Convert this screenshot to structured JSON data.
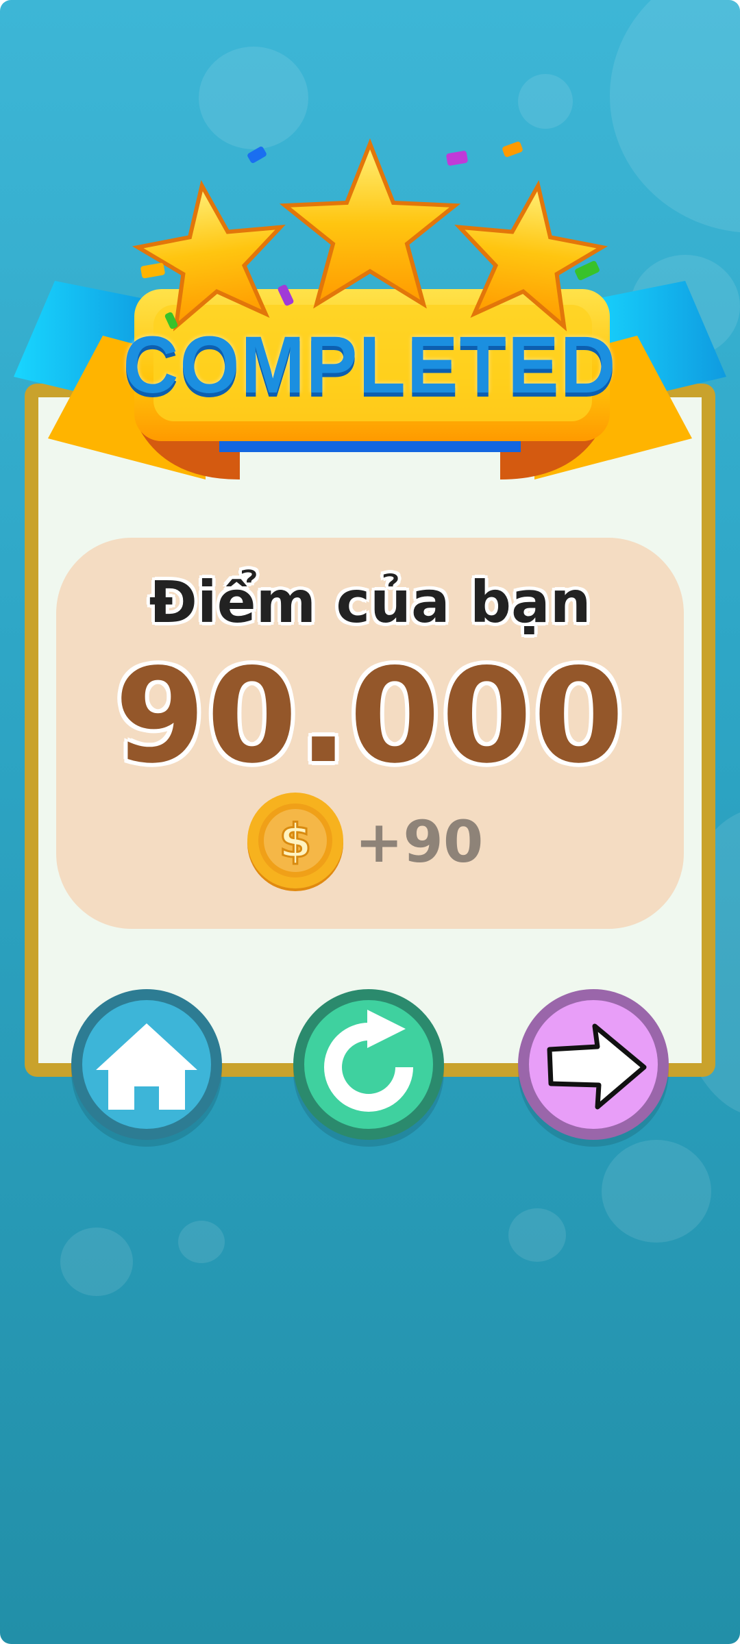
{
  "banner": {
    "title": "COMPLETED",
    "stars_earned": 3,
    "stars_total": 3
  },
  "result": {
    "score_label": "Điểm của bạn",
    "score_value": "90.000"
  },
  "reward": {
    "coins": "+90",
    "icon": "coin-dollar-icon"
  },
  "actions": {
    "home": {
      "icon": "home-icon"
    },
    "replay": {
      "icon": "replay-icon"
    },
    "next": {
      "icon": "arrow-right-icon"
    }
  },
  "colors": {
    "background": "#2ea6c6",
    "card_border": "#c9a22c",
    "score_panel": "#f4dcc2",
    "score_value": "#94572a",
    "home_button": "#3db5d8",
    "replay_button": "#3fd19f",
    "next_button": "#e89ef8"
  }
}
